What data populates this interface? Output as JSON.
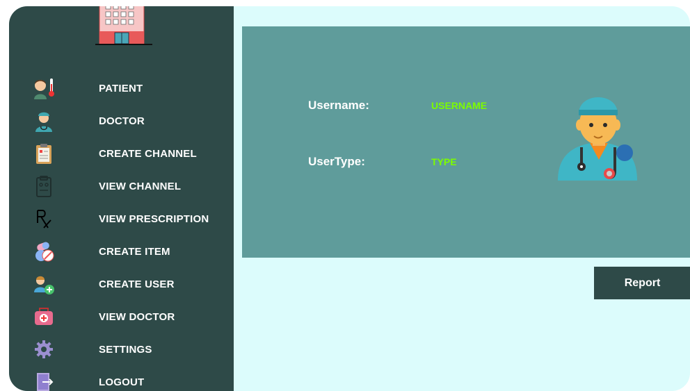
{
  "sidebar": {
    "items": [
      {
        "label": "PATIENT",
        "icon": "patient-icon"
      },
      {
        "label": "DOCTOR",
        "icon": "doctor-icon"
      },
      {
        "label": "CREATE CHANNEL",
        "icon": "clipboard-icon"
      },
      {
        "label": "VIEW CHANNEL",
        "icon": "clipboard-outline-icon"
      },
      {
        "label": "VIEW PRESCRIPTION",
        "icon": "rx-icon"
      },
      {
        "label": "CREATE ITEM",
        "icon": "pills-icon"
      },
      {
        "label": "CREATE USER",
        "icon": "add-user-icon"
      },
      {
        "label": "VIEW DOCTOR",
        "icon": "medical-kit-icon"
      },
      {
        "label": "SETTINGS",
        "icon": "gear-icon"
      },
      {
        "label": "LOGOUT",
        "icon": "logout-icon"
      }
    ]
  },
  "main": {
    "username_label": "Username:",
    "username_value": "USERNAME",
    "usertype_label": "UserType:",
    "usertype_value": "TYPE",
    "report_label": "Report"
  },
  "colors": {
    "sidebar_bg": "#2e4a48",
    "panel_bg": "#5f9c9b",
    "content_bg": "#dcfcfc",
    "value_text": "#7cfc00"
  }
}
